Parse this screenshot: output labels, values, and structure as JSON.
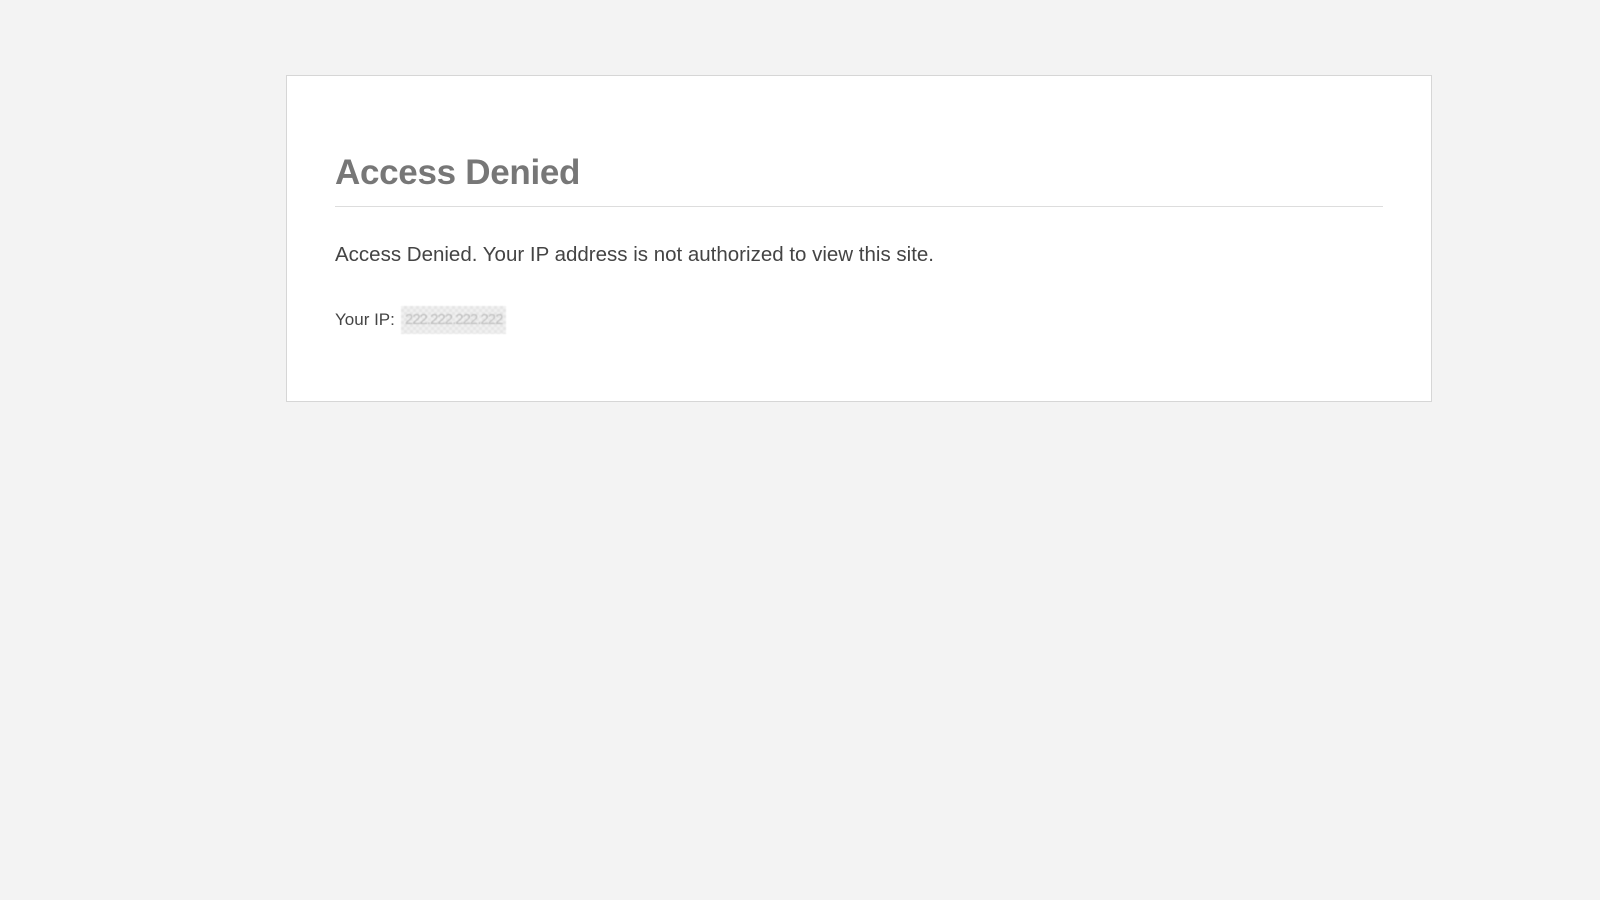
{
  "page": {
    "title": "Access Denied",
    "message": "Access Denied. Your IP address is not authorized to view this site.",
    "ip_label": "Your IP:",
    "ip_value": "222.222.222.222"
  },
  "colors": {
    "background": "#f3f3f3",
    "card": "#ffffff",
    "title": "#777777",
    "text": "#444444"
  }
}
